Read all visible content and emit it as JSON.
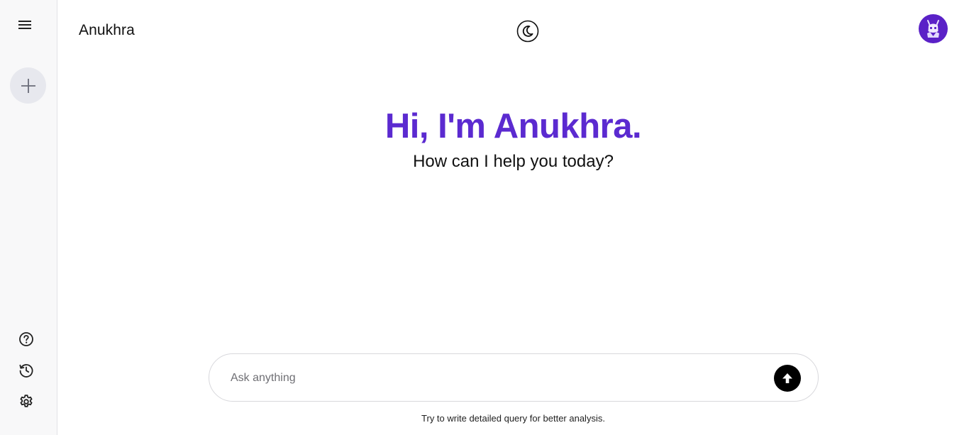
{
  "app": {
    "brand": "Anukhra"
  },
  "hero": {
    "title": "Hi, I'm Anukhra.",
    "subtitle": "How can I help you today?"
  },
  "composer": {
    "placeholder": "Ask anything",
    "value": ""
  },
  "footer": {
    "hint": "Try to write detailed query for better analysis."
  },
  "icons": {
    "menu": "hamburger-icon",
    "new_chat": "plus-icon",
    "help": "question-circle-icon",
    "history": "history-icon",
    "settings": "gear-icon",
    "theme": "moon-icon",
    "send": "arrow-up-icon",
    "avatar": "robot-avatar-icon"
  },
  "colors": {
    "accent": "#5b2ad0",
    "avatar_bg": "#5a21c7",
    "sidebar_bg": "#f8f8f9",
    "new_chat_bg": "#e7e8ee",
    "send_bg": "#000000"
  }
}
